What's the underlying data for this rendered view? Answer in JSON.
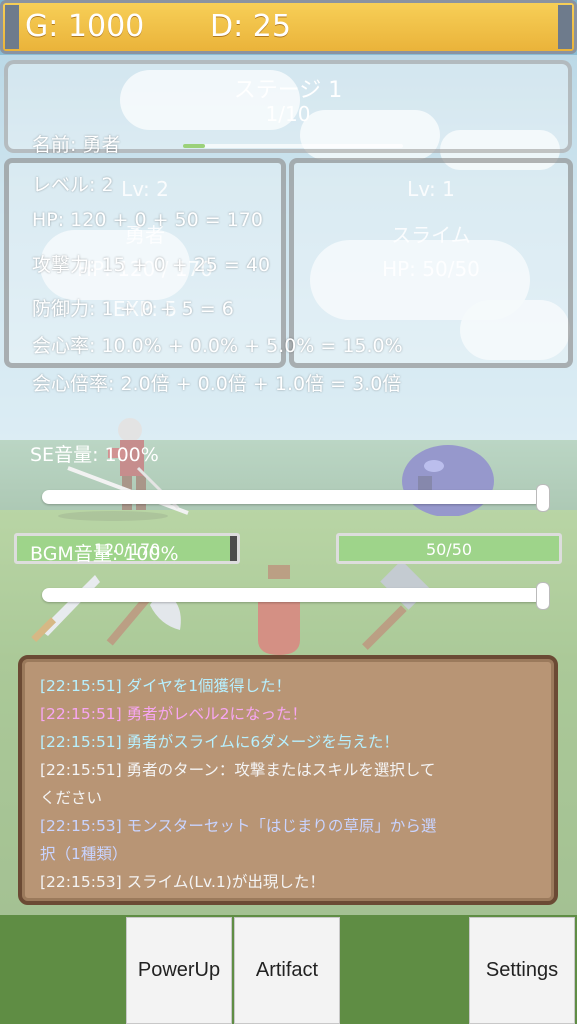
{
  "currency": {
    "gold": "G: 1000",
    "diamond": "D: 25"
  },
  "stage": {
    "title": "ステージ 1",
    "progress_text": "1/10",
    "progress_fraction": 0.1
  },
  "player_card": {
    "level": "Lv: 2",
    "name": "勇者",
    "hp": "HP: 120 / 170",
    "exp": "EXP: 5"
  },
  "enemy_card": {
    "level": "Lv: 1",
    "name": "スライム",
    "hp": "HP: 50/50"
  },
  "player_stats": {
    "name": "名前: 勇者",
    "level": "レベル: 2",
    "hp": "HP: 120 + 0 + 50 = 170",
    "attack": "攻撃力: 15 + 0 + 25 = 40",
    "defense": "防御力: 1 + 0 + 5 = 6",
    "crit_rate": "会心率: 10.0% + 0.0% + 5.0% = 15.0%",
    "crit_mult": "会心倍率: 2.0倍 + 0.0倍 + 1.0倍 = 3.0倍"
  },
  "hp_bars": {
    "player": {
      "text": "120/170",
      "fraction": 0.97
    },
    "enemy": {
      "text": "50/50",
      "fraction": 1.0
    }
  },
  "settings": {
    "se_label": "SE音量: 100%",
    "se_value": 1.0,
    "bgm_label": "BGM音量: 100%",
    "bgm_value": 1.0
  },
  "log": [
    {
      "time": "[22:15:51]",
      "text": "ダイヤを1個獲得した！",
      "color": "#b7f0ff"
    },
    {
      "time": "[22:15:51]",
      "text": "勇者がレベル2になった！",
      "color": "#f7a6f2"
    },
    {
      "time": "[22:15:51]",
      "text": "勇者がスライムに6ダメージを与えた！",
      "color": "#b7f0ff"
    },
    {
      "time": "[22:15:51]",
      "text": "勇者のターン：攻撃またはスキルを選択して",
      "color": "#f4f4f4"
    },
    {
      "time": "",
      "text": "ください",
      "color": "#f4f4f4"
    },
    {
      "time": "[22:15:53]",
      "text": "モンスターセット「はじまりの草原」から選",
      "color": "#c9d4ff"
    },
    {
      "time": "",
      "text": "択（1種類）",
      "color": "#c9d4ff"
    },
    {
      "time": "[22:15:53]",
      "text": "スライム(Lv.1)が出現した！",
      "color": "#f4f4f4"
    }
  ],
  "buttons": {
    "powerup": "PowerUp",
    "artifact": "Artifact",
    "settings": "Settings"
  },
  "colors": {
    "gold_bar": "#f2c04a",
    "hp_fill": "#9ed48a",
    "log_bg": "#b89575"
  }
}
